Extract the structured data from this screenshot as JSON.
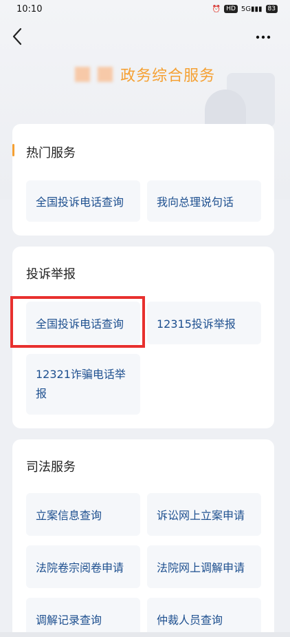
{
  "status": {
    "time": "10:10",
    "icons": [
      "alarm-icon",
      "hd-icon",
      "signal-icon",
      "battery-icon"
    ],
    "battery": "83",
    "network": "5G"
  },
  "nav": {
    "back_icon": "chevron-left-icon",
    "more_icon": "more-icon"
  },
  "page": {
    "title": "政务综合服务",
    "accent_color": "#f5a032"
  },
  "sections": {
    "hot": {
      "title": "热门服务",
      "items": [
        "全国投诉电话查询",
        "我向总理说句话"
      ]
    },
    "complaint": {
      "title": "投诉举报",
      "items": [
        "全国投诉电话查询",
        "12315投诉举报",
        "12321诈骗电话举报"
      ]
    },
    "judicial": {
      "title": "司法服务",
      "items": [
        "立案信息查询",
        "诉讼网上立案申请",
        "法院卷宗阅卷申请",
        "法院网上调解申请",
        "调解记录查询",
        "仲裁人员查询"
      ]
    }
  },
  "colors": {
    "highlight": "#e8302e",
    "link": "#1d4f8f"
  }
}
